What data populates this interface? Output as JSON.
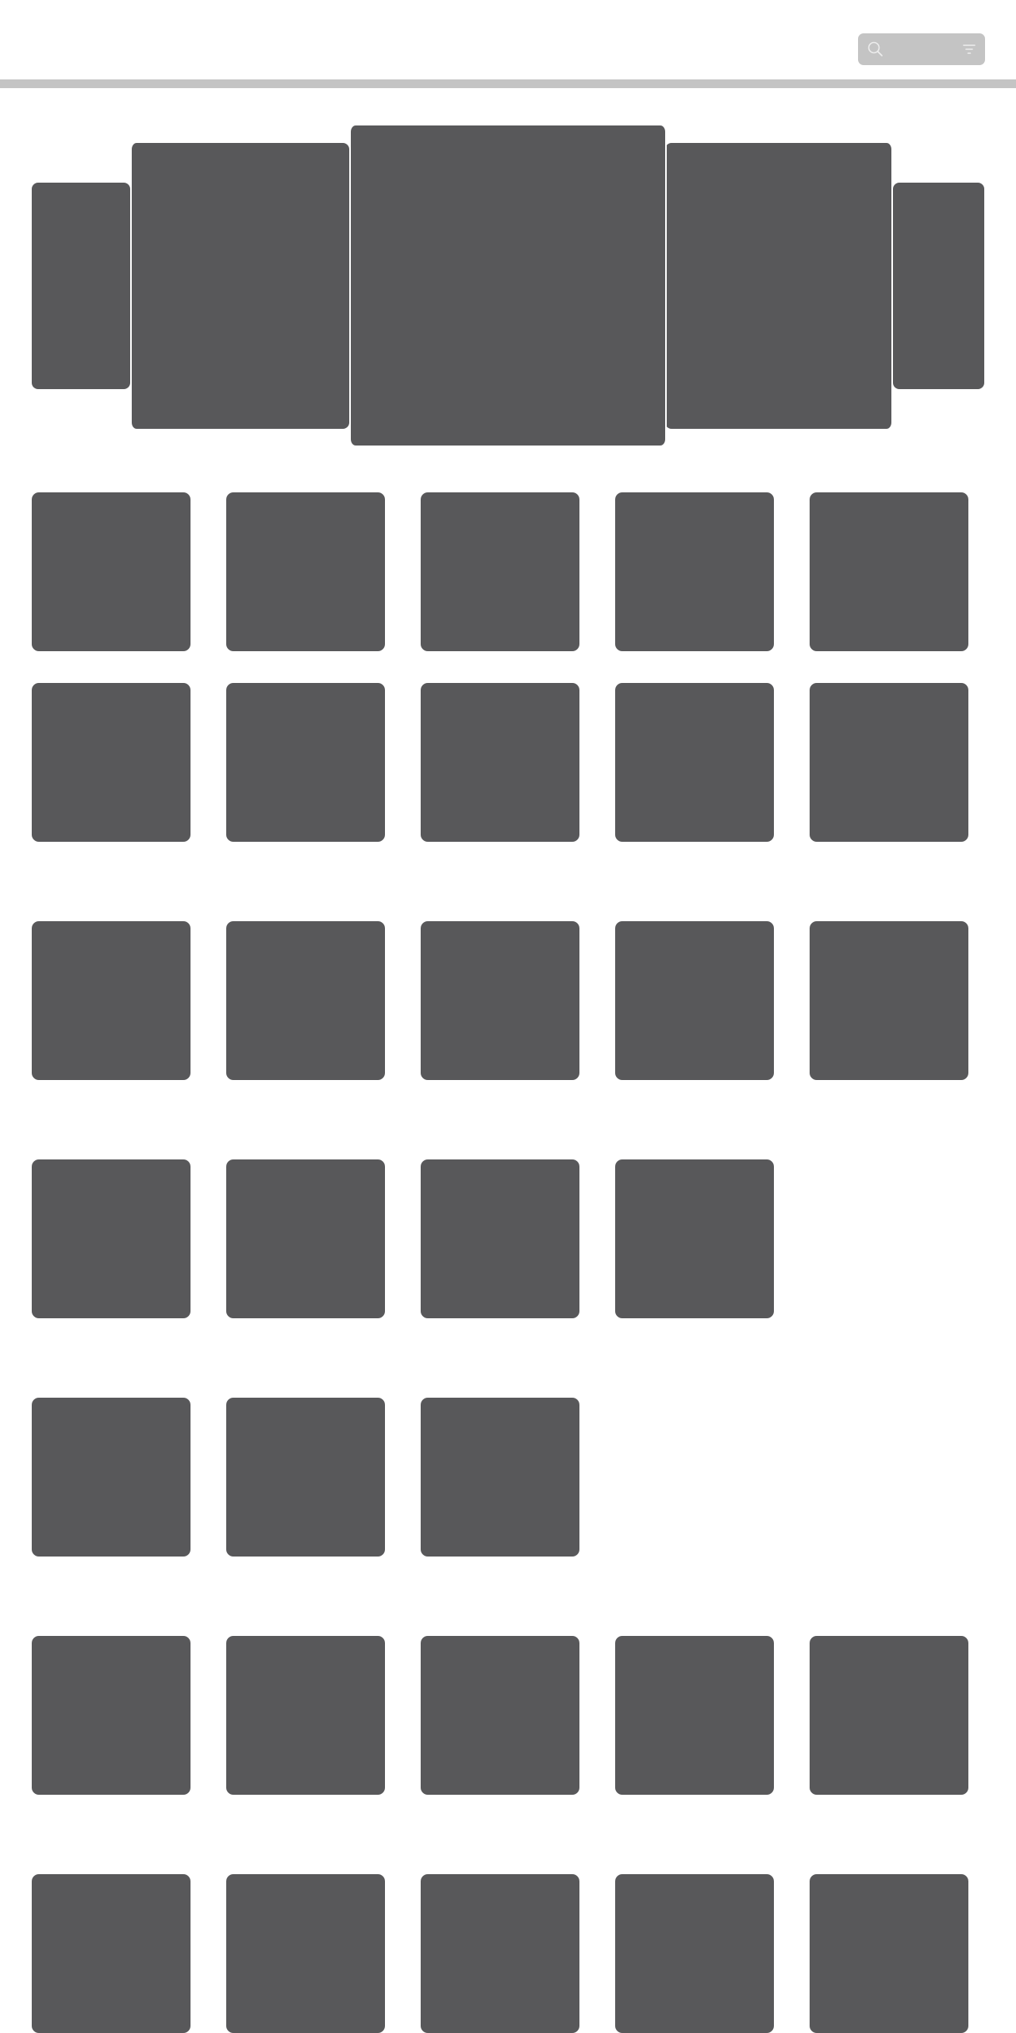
{
  "header": {
    "search": {
      "icon": "search-icon",
      "filter_icon": "filter-icon"
    }
  },
  "colors": {
    "search_bg": "#c4c4c4",
    "divider": "#c4c4c4",
    "tile": "#58585a",
    "background": "#ffffff"
  },
  "carousel": {
    "slides": [
      {
        "id": "far-left"
      },
      {
        "id": "left"
      },
      {
        "id": "center"
      },
      {
        "id": "right"
      },
      {
        "id": "far-right"
      }
    ]
  },
  "grid": {
    "rows": [
      {
        "count": 5
      },
      {
        "count": 5
      },
      {
        "count": 5
      },
      {
        "count": 4
      },
      {
        "count": 3
      },
      {
        "count": 5
      },
      {
        "count": 5
      }
    ]
  }
}
